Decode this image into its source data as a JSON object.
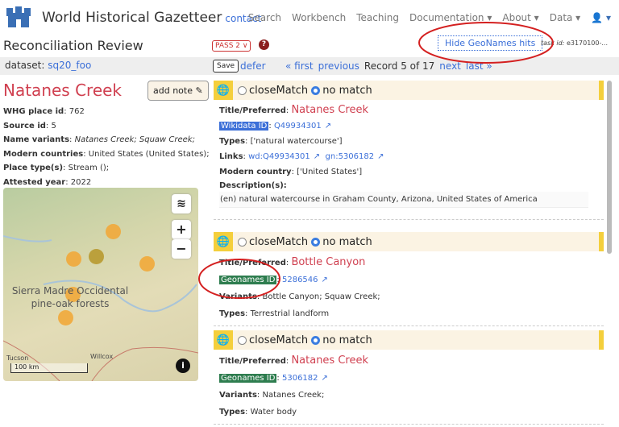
{
  "nav": {
    "brand": "World Historical Gazetteer",
    "contact": "contact",
    "items": [
      "Search",
      "Workbench",
      "Teaching",
      "Documentation ▾",
      "About ▾",
      "Data ▾",
      "👤 ▾"
    ]
  },
  "header": {
    "title": "Reconciliation Review",
    "pass": "PASS 2 ∨",
    "help": "?",
    "hide_button": "Hide GeoNames hits",
    "task_label": "task id:",
    "task_id": "e3170100-..."
  },
  "toolbar": {
    "dataset_label": "dataset:",
    "dataset": "sq20_foo",
    "save": "Save",
    "defer": "defer",
    "first": "« first",
    "previous": "previous",
    "record": "Record 5 of 17",
    "next": "next",
    "last": "last »"
  },
  "place": {
    "title": "Natanes Creek",
    "add_note": "add note ✎",
    "fields": [
      {
        "label": "WHG place id",
        "value": "762"
      },
      {
        "label": "Source id",
        "value": "5"
      },
      {
        "label": "Name variants",
        "value": "Natanes Creek; Squaw Creek;"
      },
      {
        "label": "Modern countries",
        "value": "United States (United States);"
      },
      {
        "label": "Place type(s)",
        "value": "Stream ();"
      },
      {
        "label": "Attested year",
        "value": "2022"
      }
    ]
  },
  "map": {
    "region_label": "Sierra Madre Occidental pine-oak forests",
    "city1": "Tucson",
    "city2": "Willcox",
    "scale": "100 km",
    "zoom_in": "+",
    "zoom_out": "−",
    "info": "i"
  },
  "match_options": {
    "close": "closeMatch",
    "none": "no match",
    "selected": "no match"
  },
  "hits": [
    {
      "title_label": "Title/Preferred",
      "title": "Natanes Creek",
      "id_label": "Wikidata ID",
      "id": "Q49934301",
      "id_color": "#3b6fd8",
      "types_label": "Types",
      "types": "['natural watercourse']",
      "links_label": "Links",
      "links": [
        "wd:Q49934301",
        "gn:5306182"
      ],
      "country_label": "Modern country",
      "country": "['United States']",
      "desc_label": "Description(s):",
      "desc": "(en) natural watercourse in Graham County, Arizona, United States of America"
    },
    {
      "title_label": "Title/Preferred",
      "title": "Bottle Canyon",
      "id_label": "Geonames ID",
      "id": "5286546",
      "id_color": "#2e7d4f",
      "variants_label": "Variants",
      "variants": "Bottle Canyon; Squaw Creek;",
      "types_label": "Types",
      "types": "Terrestrial landform"
    },
    {
      "title_label": "Title/Preferred",
      "title": "Natanes Creek",
      "id_label": "Geonames ID",
      "id": "5306182",
      "id_color": "#2e7d4f",
      "variants_label": "Variants",
      "variants": "Natanes Creek;",
      "types_label": "Types",
      "types": "Water body"
    }
  ],
  "colors": {
    "accent_red": "#d04050",
    "link": "#3b6fd8",
    "highlight_yellow": "#f4cf3c",
    "annotation": "#d42020"
  }
}
